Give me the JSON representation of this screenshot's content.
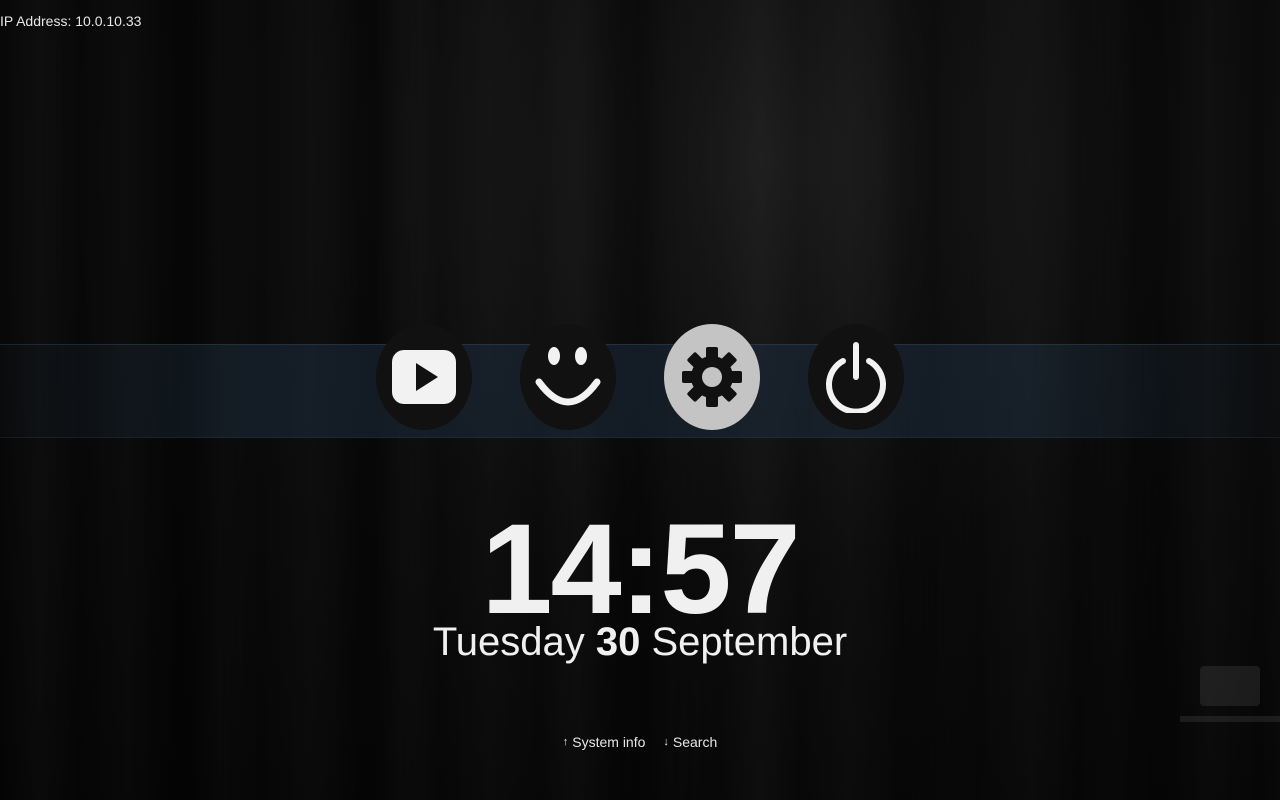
{
  "status": {
    "ip_label": "IP Address: 10.0.10.33"
  },
  "menu": {
    "items": [
      {
        "icon": "youtube-play-icon",
        "selected": false
      },
      {
        "icon": "smiley-icon",
        "selected": false
      },
      {
        "icon": "gear-icon",
        "selected": true
      },
      {
        "icon": "power-icon",
        "selected": false
      }
    ]
  },
  "clock": {
    "time": "14:57",
    "weekday": "Tuesday",
    "day": "30",
    "month": "September"
  },
  "hints": {
    "up_arrow": "↑",
    "up_label": "System info",
    "down_arrow": "↓",
    "down_label": "Search"
  },
  "colors": {
    "selected_bg": "#c4c4c4",
    "item_bg": "#111111",
    "band": "#1c2c3c"
  }
}
